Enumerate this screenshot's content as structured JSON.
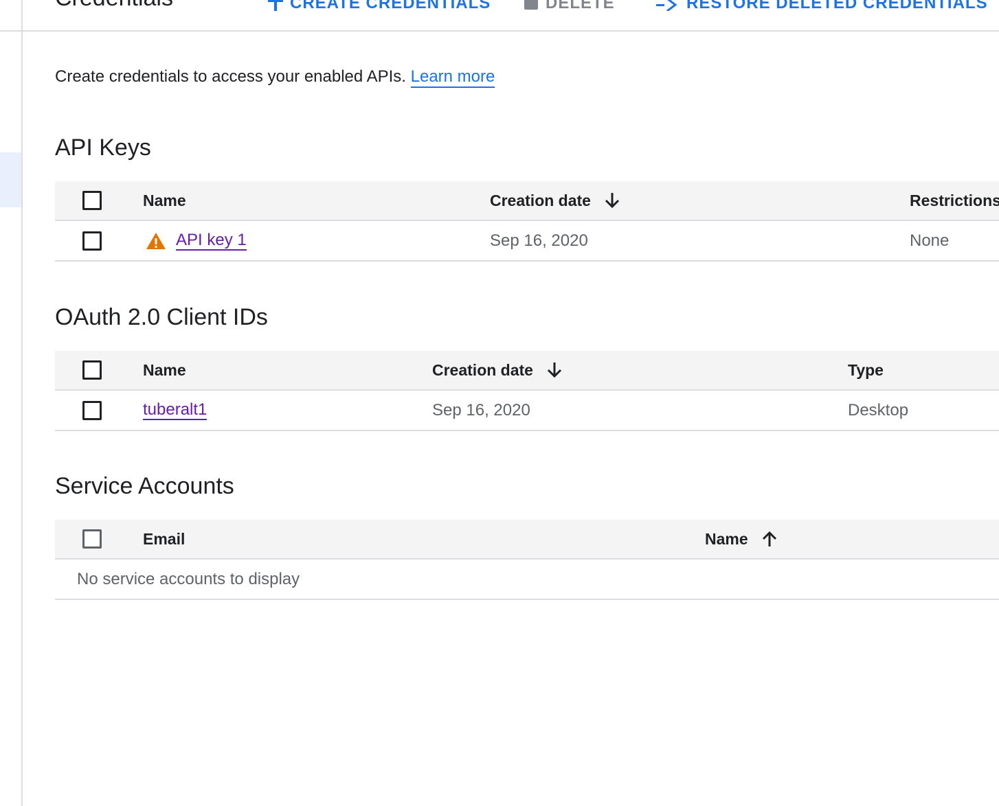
{
  "header": {
    "title": "Credentials",
    "create_label": "CREATE CREDENTIALS",
    "delete_label": "DELETE",
    "restore_label": "RESTORE DELETED CREDENTIALS"
  },
  "intro": {
    "text": "Create credentials to access your enabled APIs.",
    "learn_more": "Learn more"
  },
  "api_keys": {
    "title": "API Keys",
    "columns": {
      "name": "Name",
      "creation_date": "Creation date",
      "restrictions": "Restrictions"
    },
    "rows": [
      {
        "name": "API key 1",
        "creation_date": "Sep 16, 2020",
        "restrictions": "None",
        "icon": "warning-icon"
      }
    ]
  },
  "oauth": {
    "title": "OAuth 2.0 Client IDs",
    "columns": {
      "name": "Name",
      "creation_date": "Creation date",
      "type": "Type"
    },
    "rows": [
      {
        "name": "tuberalt1",
        "creation_date": "Sep 16, 2020",
        "type": "Desktop"
      }
    ]
  },
  "service_accounts": {
    "title": "Service Accounts",
    "columns": {
      "email": "Email",
      "name": "Name"
    },
    "empty_message": "No service accounts to display"
  },
  "colors": {
    "link_blue": "#1a73e8",
    "visited_purple": "#681da8",
    "warning_orange": "#e37400",
    "header_bg": "#f4f4f4",
    "divider": "#dadce0"
  }
}
